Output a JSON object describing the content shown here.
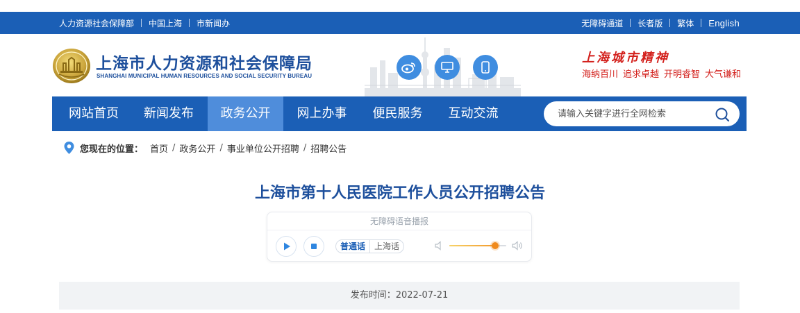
{
  "topbar": {
    "left_links": [
      "人力资源社会保障部",
      "中国上海",
      "市新闻办"
    ],
    "right_links": [
      "无障碍通道",
      "长者版",
      "繁体",
      "English"
    ]
  },
  "header": {
    "title": "上海市人力资源和社会保障局",
    "subtitle": "SHANGHAI MUNICIPAL HUMAN RESOURCES AND SOCIAL SECURITY BUREAU",
    "icons": [
      "weibo-icon",
      "desktop-icon",
      "mobile-icon"
    ],
    "spirit_title": "上海城市精神",
    "spirit_words": [
      "海纳百川",
      "追求卓越",
      "开明睿智",
      "大气谦和"
    ]
  },
  "nav": {
    "items": [
      "网站首页",
      "新闻发布",
      "政务公开",
      "网上办事",
      "便民服务",
      "互动交流"
    ],
    "active_index": 2,
    "search_placeholder": "请输入关键字进行全网检索"
  },
  "breadcrumb": {
    "lead": "您现在的位置：",
    "items": [
      "首页",
      "政务公开",
      "事业单位公开招聘",
      "招聘公告"
    ]
  },
  "article": {
    "title": "上海市第十人民医院工作人员公开招聘公告",
    "publish_label": "发布时间：2022-07-21"
  },
  "audio_player": {
    "header": "无障碍语音播报",
    "languages": [
      "普通话",
      "上海话"
    ],
    "selected_language": "普通话",
    "volume_fraction": 0.8
  },
  "colors": {
    "primary_blue": "#1b5fb6",
    "active_nav": "#4f8ddb",
    "title_blue": "#1d4f9c",
    "spirit_red": "#d3201c",
    "volume_accent": "#f08a1c"
  }
}
